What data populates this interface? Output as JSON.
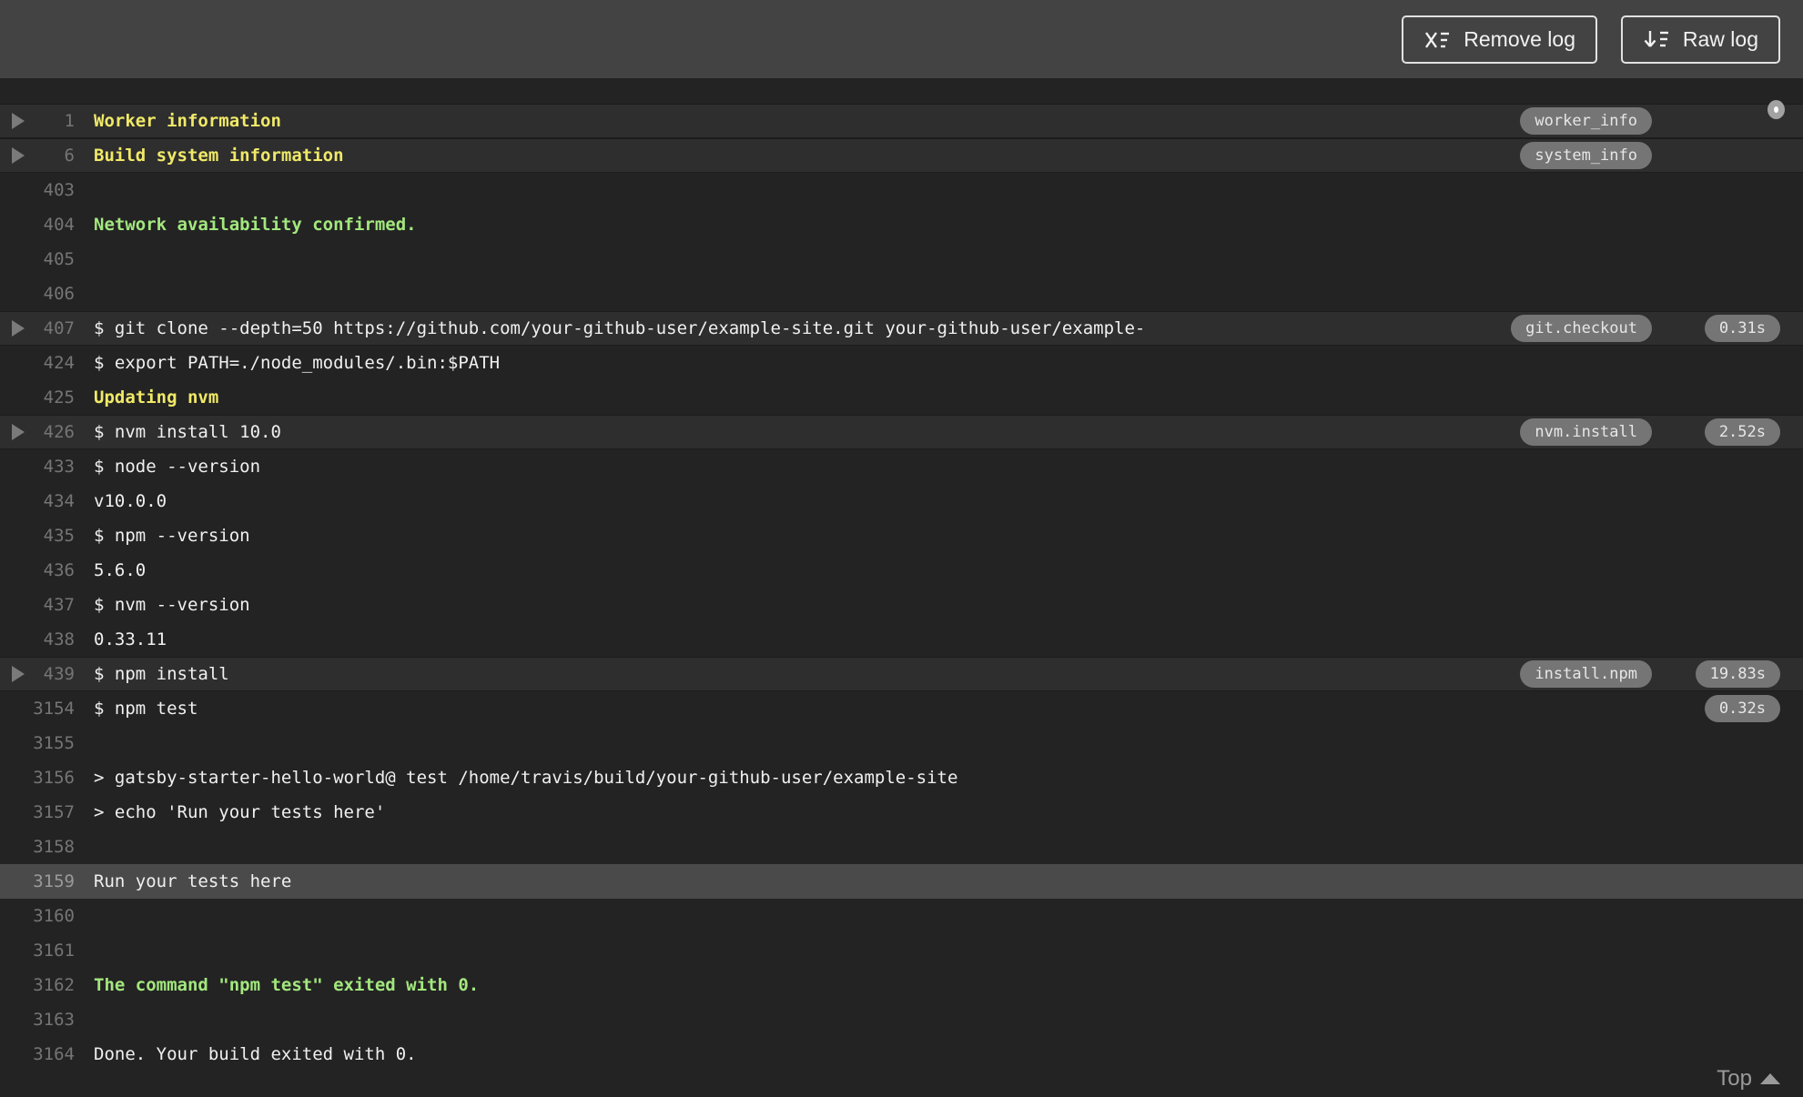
{
  "toolbar": {
    "remove_log_label": "Remove log",
    "raw_log_label": "Raw log"
  },
  "log": {
    "top_link_label": "Top",
    "lines": [
      {
        "num": "1",
        "text": "Worker information",
        "color": "yellow",
        "bold": true,
        "fold": true,
        "badge": "worker_info"
      },
      {
        "num": "6",
        "text": "Build system information",
        "color": "yellow",
        "bold": true,
        "fold": true,
        "badge": "system_info"
      },
      {
        "num": "403",
        "text": ""
      },
      {
        "num": "404",
        "text": "Network availability confirmed.",
        "color": "green",
        "bold": true
      },
      {
        "num": "405",
        "text": ""
      },
      {
        "num": "406",
        "text": ""
      },
      {
        "num": "407",
        "text": "$ git clone --depth=50 https://github.com/your-github-user/example-site.git your-github-user/example-",
        "fold": true,
        "badge": "git.checkout",
        "duration": "0.31s"
      },
      {
        "num": "424",
        "text": "$ export PATH=./node_modules/.bin:$PATH"
      },
      {
        "num": "425",
        "text": "Updating nvm",
        "color": "yellow",
        "bold": true
      },
      {
        "num": "426",
        "text": "$ nvm install 10.0",
        "fold": true,
        "badge": "nvm.install",
        "duration": "2.52s"
      },
      {
        "num": "433",
        "text": "$ node --version"
      },
      {
        "num": "434",
        "text": "v10.0.0"
      },
      {
        "num": "435",
        "text": "$ npm --version"
      },
      {
        "num": "436",
        "text": "5.6.0"
      },
      {
        "num": "437",
        "text": "$ nvm --version"
      },
      {
        "num": "438",
        "text": "0.33.11"
      },
      {
        "num": "439",
        "text": "$ npm install",
        "fold": true,
        "badge": "install.npm",
        "duration": "19.83s"
      },
      {
        "num": "3154",
        "text": "$ npm test",
        "duration": "0.32s"
      },
      {
        "num": "3155",
        "text": ""
      },
      {
        "num": "3156",
        "text": "> gatsby-starter-hello-world@ test /home/travis/build/your-github-user/example-site"
      },
      {
        "num": "3157",
        "text": "> echo 'Run your tests here'"
      },
      {
        "num": "3158",
        "text": ""
      },
      {
        "num": "3159",
        "text": "Run your tests here",
        "selected": true
      },
      {
        "num": "3160",
        "text": ""
      },
      {
        "num": "3161",
        "text": ""
      },
      {
        "num": "3162",
        "text": "The command \"npm test\" exited with 0.",
        "color": "green",
        "bold": true
      },
      {
        "num": "3163",
        "text": ""
      },
      {
        "num": "3164",
        "text": "Done. Your build exited with 0."
      }
    ]
  },
  "colors": {
    "toolbar_bg": "#434343",
    "log_bg": "#232323",
    "fold_row_bg": "#2e2e2e",
    "selected_row_bg": "#4a4a4a",
    "yellow_text": "#f0e968",
    "green_text": "#a3e77e",
    "default_text": "#f0f0f0",
    "line_number": "#757575",
    "badge_bg": "#757575"
  }
}
